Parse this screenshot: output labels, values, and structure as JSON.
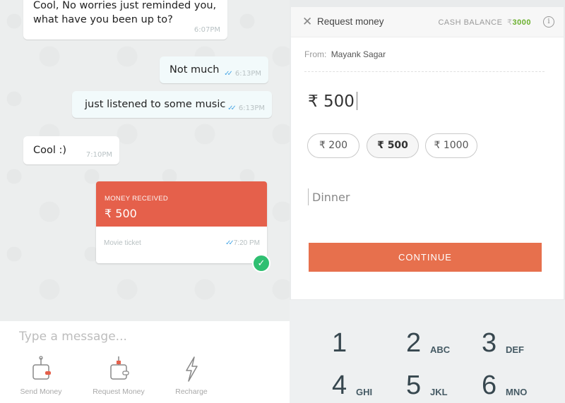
{
  "chat": {
    "messages": [
      {
        "text": "Cool, No worries just reminded you, what have you been up to?",
        "time": "6:07PM"
      },
      {
        "text": "Not much",
        "time": "6:13PM"
      },
      {
        "text": "just listened to some music",
        "time": "6:13PM"
      },
      {
        "text": "Cool :)",
        "time": "7:10PM"
      }
    ],
    "money_card": {
      "label": "MONEY RECEIVED",
      "amount": "₹ 500",
      "note": "Movie ticket",
      "time": "7:20 PM"
    },
    "composer": {
      "placeholder": "Type a message...",
      "actions": [
        {
          "label": "Send Money",
          "icon": "send-money-icon"
        },
        {
          "label": "Request Money",
          "icon": "request-money-icon"
        },
        {
          "label": "Recharge",
          "icon": "recharge-icon"
        }
      ]
    }
  },
  "request": {
    "title": "Request money",
    "cash_balance_label": "CASH BALANCE",
    "currency_symbol": "₹",
    "cash_balance_value": "3000",
    "from_label": "From:",
    "from_name": "Mayank Sagar",
    "amount": "₹ 500",
    "chips": [
      "₹ 200",
      "₹ 500",
      "₹ 1000"
    ],
    "selected_chip": "₹ 500",
    "note_placeholder": "Dinner",
    "continue_label": "CONTINUE",
    "colors": {
      "accent": "#e7704d",
      "money_card": "#e5604b",
      "balance": "#6ab02d",
      "check": "#2fbf71"
    }
  },
  "keypad": {
    "keys": [
      {
        "num": "1",
        "letters": ""
      },
      {
        "num": "2",
        "letters": "ABC"
      },
      {
        "num": "3",
        "letters": "DEF"
      },
      {
        "num": "4",
        "letters": "GHI"
      },
      {
        "num": "5",
        "letters": "JKL"
      },
      {
        "num": "6",
        "letters": "MNO"
      }
    ]
  }
}
